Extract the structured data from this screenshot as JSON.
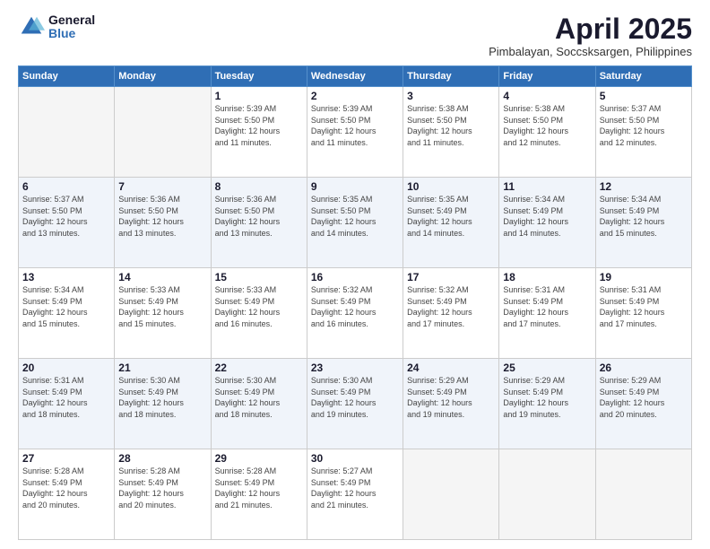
{
  "logo": {
    "general": "General",
    "blue": "Blue"
  },
  "title": "April 2025",
  "subtitle": "Pimbalayan, Soccsksargen, Philippines",
  "weekdays": [
    "Sunday",
    "Monday",
    "Tuesday",
    "Wednesday",
    "Thursday",
    "Friday",
    "Saturday"
  ],
  "weeks": [
    [
      {
        "day": "",
        "sunrise": "",
        "sunset": "",
        "daylight": ""
      },
      {
        "day": "",
        "sunrise": "",
        "sunset": "",
        "daylight": ""
      },
      {
        "day": "1",
        "sunrise": "Sunrise: 5:39 AM",
        "sunset": "Sunset: 5:50 PM",
        "daylight": "Daylight: 12 hours and 11 minutes."
      },
      {
        "day": "2",
        "sunrise": "Sunrise: 5:39 AM",
        "sunset": "Sunset: 5:50 PM",
        "daylight": "Daylight: 12 hours and 11 minutes."
      },
      {
        "day": "3",
        "sunrise": "Sunrise: 5:38 AM",
        "sunset": "Sunset: 5:50 PM",
        "daylight": "Daylight: 12 hours and 11 minutes."
      },
      {
        "day": "4",
        "sunrise": "Sunrise: 5:38 AM",
        "sunset": "Sunset: 5:50 PM",
        "daylight": "Daylight: 12 hours and 12 minutes."
      },
      {
        "day": "5",
        "sunrise": "Sunrise: 5:37 AM",
        "sunset": "Sunset: 5:50 PM",
        "daylight": "Daylight: 12 hours and 12 minutes."
      }
    ],
    [
      {
        "day": "6",
        "sunrise": "Sunrise: 5:37 AM",
        "sunset": "Sunset: 5:50 PM",
        "daylight": "Daylight: 12 hours and 13 minutes."
      },
      {
        "day": "7",
        "sunrise": "Sunrise: 5:36 AM",
        "sunset": "Sunset: 5:50 PM",
        "daylight": "Daylight: 12 hours and 13 minutes."
      },
      {
        "day": "8",
        "sunrise": "Sunrise: 5:36 AM",
        "sunset": "Sunset: 5:50 PM",
        "daylight": "Daylight: 12 hours and 13 minutes."
      },
      {
        "day": "9",
        "sunrise": "Sunrise: 5:35 AM",
        "sunset": "Sunset: 5:50 PM",
        "daylight": "Daylight: 12 hours and 14 minutes."
      },
      {
        "day": "10",
        "sunrise": "Sunrise: 5:35 AM",
        "sunset": "Sunset: 5:49 PM",
        "daylight": "Daylight: 12 hours and 14 minutes."
      },
      {
        "day": "11",
        "sunrise": "Sunrise: 5:34 AM",
        "sunset": "Sunset: 5:49 PM",
        "daylight": "Daylight: 12 hours and 14 minutes."
      },
      {
        "day": "12",
        "sunrise": "Sunrise: 5:34 AM",
        "sunset": "Sunset: 5:49 PM",
        "daylight": "Daylight: 12 hours and 15 minutes."
      }
    ],
    [
      {
        "day": "13",
        "sunrise": "Sunrise: 5:34 AM",
        "sunset": "Sunset: 5:49 PM",
        "daylight": "Daylight: 12 hours and 15 minutes."
      },
      {
        "day": "14",
        "sunrise": "Sunrise: 5:33 AM",
        "sunset": "Sunset: 5:49 PM",
        "daylight": "Daylight: 12 hours and 15 minutes."
      },
      {
        "day": "15",
        "sunrise": "Sunrise: 5:33 AM",
        "sunset": "Sunset: 5:49 PM",
        "daylight": "Daylight: 12 hours and 16 minutes."
      },
      {
        "day": "16",
        "sunrise": "Sunrise: 5:32 AM",
        "sunset": "Sunset: 5:49 PM",
        "daylight": "Daylight: 12 hours and 16 minutes."
      },
      {
        "day": "17",
        "sunrise": "Sunrise: 5:32 AM",
        "sunset": "Sunset: 5:49 PM",
        "daylight": "Daylight: 12 hours and 17 minutes."
      },
      {
        "day": "18",
        "sunrise": "Sunrise: 5:31 AM",
        "sunset": "Sunset: 5:49 PM",
        "daylight": "Daylight: 12 hours and 17 minutes."
      },
      {
        "day": "19",
        "sunrise": "Sunrise: 5:31 AM",
        "sunset": "Sunset: 5:49 PM",
        "daylight": "Daylight: 12 hours and 17 minutes."
      }
    ],
    [
      {
        "day": "20",
        "sunrise": "Sunrise: 5:31 AM",
        "sunset": "Sunset: 5:49 PM",
        "daylight": "Daylight: 12 hours and 18 minutes."
      },
      {
        "day": "21",
        "sunrise": "Sunrise: 5:30 AM",
        "sunset": "Sunset: 5:49 PM",
        "daylight": "Daylight: 12 hours and 18 minutes."
      },
      {
        "day": "22",
        "sunrise": "Sunrise: 5:30 AM",
        "sunset": "Sunset: 5:49 PM",
        "daylight": "Daylight: 12 hours and 18 minutes."
      },
      {
        "day": "23",
        "sunrise": "Sunrise: 5:30 AM",
        "sunset": "Sunset: 5:49 PM",
        "daylight": "Daylight: 12 hours and 19 minutes."
      },
      {
        "day": "24",
        "sunrise": "Sunrise: 5:29 AM",
        "sunset": "Sunset: 5:49 PM",
        "daylight": "Daylight: 12 hours and 19 minutes."
      },
      {
        "day": "25",
        "sunrise": "Sunrise: 5:29 AM",
        "sunset": "Sunset: 5:49 PM",
        "daylight": "Daylight: 12 hours and 19 minutes."
      },
      {
        "day": "26",
        "sunrise": "Sunrise: 5:29 AM",
        "sunset": "Sunset: 5:49 PM",
        "daylight": "Daylight: 12 hours and 20 minutes."
      }
    ],
    [
      {
        "day": "27",
        "sunrise": "Sunrise: 5:28 AM",
        "sunset": "Sunset: 5:49 PM",
        "daylight": "Daylight: 12 hours and 20 minutes."
      },
      {
        "day": "28",
        "sunrise": "Sunrise: 5:28 AM",
        "sunset": "Sunset: 5:49 PM",
        "daylight": "Daylight: 12 hours and 20 minutes."
      },
      {
        "day": "29",
        "sunrise": "Sunrise: 5:28 AM",
        "sunset": "Sunset: 5:49 PM",
        "daylight": "Daylight: 12 hours and 21 minutes."
      },
      {
        "day": "30",
        "sunrise": "Sunrise: 5:27 AM",
        "sunset": "Sunset: 5:49 PM",
        "daylight": "Daylight: 12 hours and 21 minutes."
      },
      {
        "day": "",
        "sunrise": "",
        "sunset": "",
        "daylight": ""
      },
      {
        "day": "",
        "sunrise": "",
        "sunset": "",
        "daylight": ""
      },
      {
        "day": "",
        "sunrise": "",
        "sunset": "",
        "daylight": ""
      }
    ]
  ]
}
